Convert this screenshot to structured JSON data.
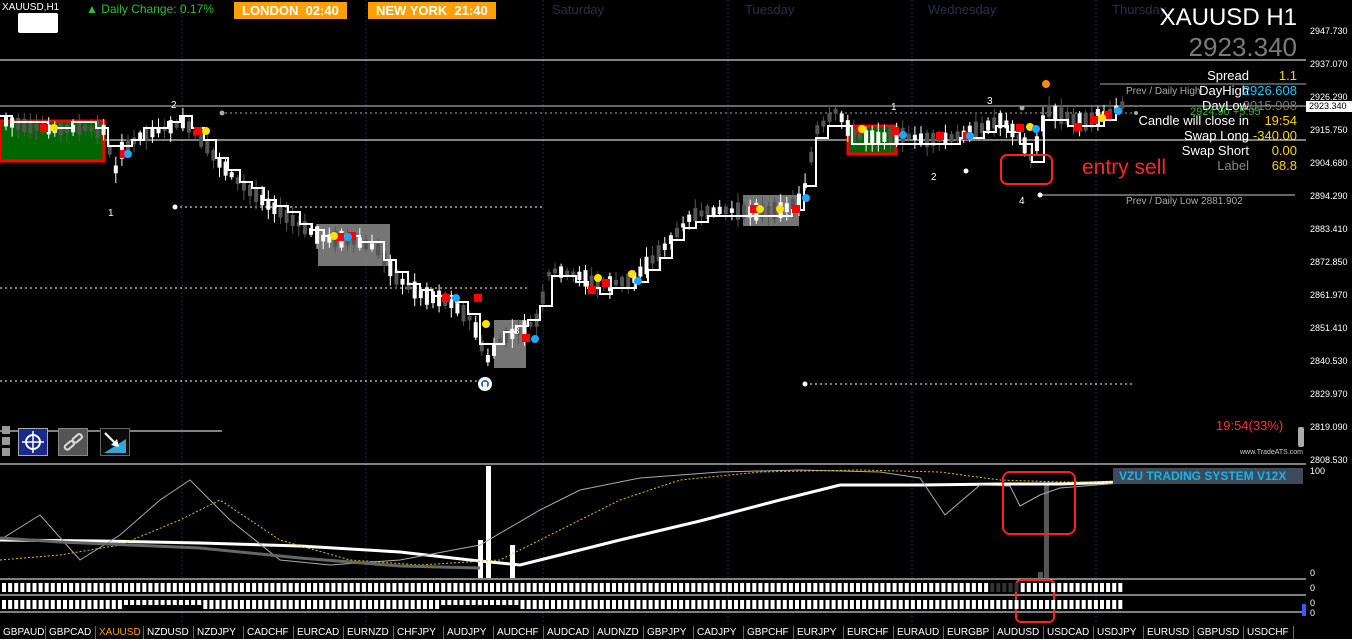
{
  "header": {
    "symbol_label": "XAUUSD,H1",
    "daily_change": "▲ Daily Change: 0.17%",
    "sessions": [
      {
        "name": "LONDON",
        "time": "02:40"
      },
      {
        "name": "NEW YORK",
        "time": "21:40"
      }
    ],
    "days": [
      "Saturday",
      "Tuesday",
      "Wednesday",
      "Thursday"
    ]
  },
  "title": {
    "symbol": "XAUUSD H1",
    "price": "2923.340"
  },
  "info_panel": {
    "rows": [
      {
        "label": "Spread",
        "value": "1.1"
      },
      {
        "label": "DayHigh",
        "value": "2926.608"
      },
      {
        "label": "DayLow",
        "value": "2915.908"
      },
      {
        "label": "Candle will close in",
        "value": "19:54"
      },
      {
        "label": "Swap Long",
        "value": "-340.00"
      },
      {
        "label": "Swap Short",
        "value": "0.00"
      },
      {
        "label": "Label",
        "value": "68.8"
      }
    ],
    "overlay_text": "2924.90 +5.95"
  },
  "annotations": {
    "prev_daily_high": "Prev / Daily High",
    "prev_daily_low": "Prev / Daily Low 2881.902",
    "entry_sell": "entry sell",
    "countdown": "19:54(33%)",
    "watermark": "www.TradeATS.com",
    "wave_labels": [
      "1",
      "2",
      "1",
      "2",
      "3",
      "4",
      "3"
    ]
  },
  "price_axis": {
    "ticks": [
      "2947.730",
      "2937.070",
      "2926.290",
      "2915.750",
      "2904.680",
      "2894.290",
      "2883.410",
      "2872.850",
      "2861.970",
      "2851.410",
      "2840.530",
      "2829.970",
      "2819.090",
      "2808.530"
    ],
    "current": "2923.340"
  },
  "indicator": {
    "name": "VZU TRADING SYSTEM V12X",
    "axis": [
      "100",
      "0",
      "0",
      "0",
      "0"
    ]
  },
  "symbol_tabs": [
    "GBPAUD",
    "GBPCAD",
    "XAUUSD",
    "NZDUSD",
    "NZDJPY",
    "CADCHF",
    "EURCAD",
    "EURNZD",
    "CHFJPY",
    "AUDJPY",
    "AUDCHF",
    "AUDCAD",
    "AUDNZD",
    "GBPJPY",
    "CADJPY",
    "GBPCHF",
    "EURJPY",
    "EURCHF",
    "EURAUD",
    "EURGBP",
    "AUDUSD",
    "USDCAD",
    "USDJPY",
    "EURUSD",
    "GBPUSD",
    "USDCHF"
  ],
  "active_tab": "XAUUSD",
  "colors": {
    "bull": "#ffffff",
    "bear": "#555555",
    "session_orange": "#ffa000",
    "signal_red": "#ff0000",
    "signal_yellow": "#ffe000",
    "signal_blue": "#1ea7ff",
    "green_zone": "#006600",
    "gray_zone": "#9a9a9a"
  },
  "toolbar_icons": [
    "crosshair-icon",
    "link-icon",
    "chart-arrow-icon"
  ]
}
